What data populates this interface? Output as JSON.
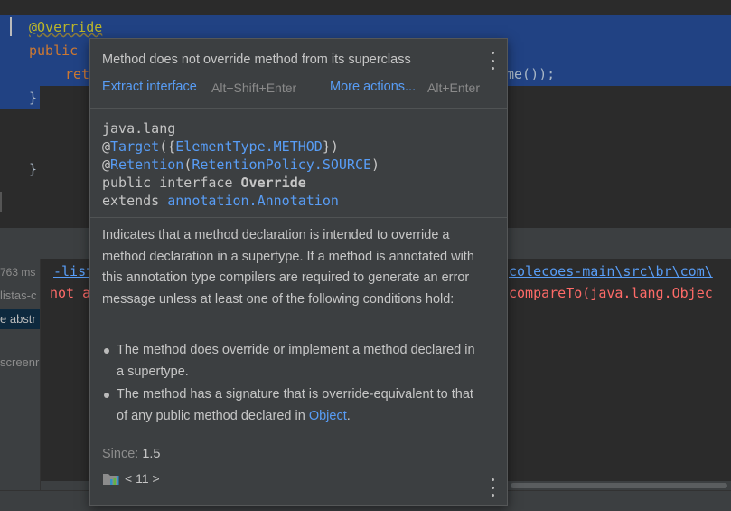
{
  "editor": {
    "lines": {
      "override": "@Override",
      "public": "public",
      "ret": "ret",
      "tail": "me());",
      "close1": "}",
      "close2": "}"
    }
  },
  "panel": {
    "left": {
      "time": "763 ms",
      "item1": "listas-c",
      "item2": "e abstr",
      "item3": "screenr"
    },
    "output": {
      "line1_left": "-list",
      "line1_right": "colecoes-main\\src\\br\\com\\",
      "line2_left": "not a",
      "line2_right": "compareTo(java.lang.Objec"
    }
  },
  "popup": {
    "message": "Method does not override method from its superclass",
    "actions": [
      {
        "label": "Extract interface",
        "shortcut": "Alt+Shift+Enter"
      },
      {
        "label": "More actions...",
        "shortcut": "Alt+Enter"
      }
    ],
    "signature": {
      "package": "java.lang",
      "target_at": "@",
      "target_name": "Target",
      "target_open": "({",
      "target_value": "ElementType.METHOD",
      "target_close": "})",
      "retention_at": "@",
      "retention_name": "Retention",
      "retention_open": "(",
      "retention_value": "RetentionPolicy.SOURCE",
      "retention_close": ")",
      "decl_prefix": "public interface ",
      "decl_name": "Override",
      "extends_prefix": "extends ",
      "extends_value": "annotation.Annotation"
    },
    "description": "Indicates that a method declaration is intended to override a method declaration in a supertype. If a method is annotated with this annotation type compilers are required to generate an error message unless at least one of the following conditions hold:",
    "bullets": [
      {
        "text": "The method does override or implement a method declared in a supertype."
      },
      {
        "text": "The method has a signature that is override-equivalent to that of any public method declared in ",
        "link": "Object",
        "suffix": "."
      }
    ],
    "since_label": "Since:",
    "since_value": "1.5",
    "library": "< 11 >"
  },
  "colors": {
    "selection": "#214283",
    "link": "#589df6",
    "annotation": "#bbb529",
    "keyword": "#cc7832"
  }
}
